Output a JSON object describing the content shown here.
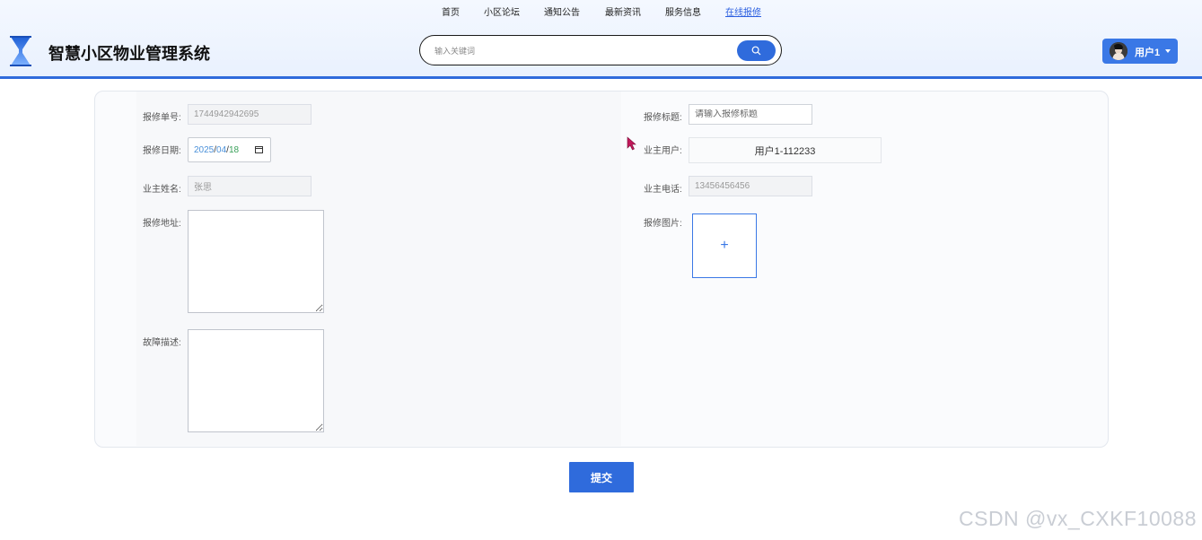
{
  "nav": {
    "items": [
      {
        "label": "首页",
        "active": false
      },
      {
        "label": "小区论坛",
        "active": false
      },
      {
        "label": "通知公告",
        "active": false
      },
      {
        "label": "最新资讯",
        "active": false
      },
      {
        "label": "服务信息",
        "active": false
      },
      {
        "label": "在线报修",
        "active": true
      }
    ]
  },
  "header": {
    "title": "智慧小区物业管理系统",
    "logo_icon": "hourglass-icon",
    "search": {
      "placeholder": "输入关键词",
      "value": "",
      "button_icon": "search-icon"
    },
    "user": {
      "name": "用户1",
      "menu_icon": "caret-down-icon"
    }
  },
  "form": {
    "order_no": {
      "label": "报修单号:",
      "value": "1744942942695"
    },
    "title": {
      "label": "报修标题:",
      "placeholder": "请输入报修标题",
      "value": ""
    },
    "date": {
      "label": "报修日期:",
      "year": "2025",
      "month": "04",
      "day": "18",
      "sep": "/"
    },
    "owner_user": {
      "label": "业主用户:",
      "value": "用户1-112233"
    },
    "owner_name": {
      "label": "业主姓名:",
      "value": "张思"
    },
    "owner_phone": {
      "label": "业主电话:",
      "value": "13456456456"
    },
    "address": {
      "label": "报修地址:",
      "value": ""
    },
    "image": {
      "label": "报修图片:",
      "upload_symbol": "+"
    },
    "description": {
      "label": "故障描述:",
      "value": ""
    },
    "submit_label": "提交"
  },
  "watermark": "CSDN @vx_CXKF10088",
  "colors": {
    "primary": "#2f6bdc",
    "header_bg": "#eef4fe",
    "card_bg": "#fafbfd"
  }
}
